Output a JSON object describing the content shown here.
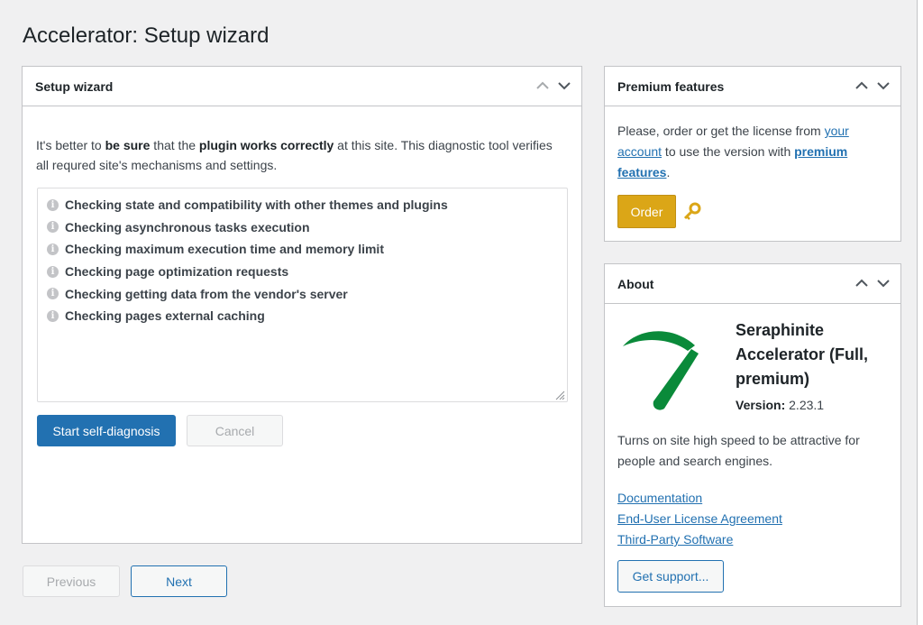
{
  "page": {
    "title": "Accelerator: Setup wizard"
  },
  "wizard": {
    "title": "Setup wizard",
    "intro": {
      "p1": "It's better to ",
      "b1": "be sure",
      "p2": " that the ",
      "b2": "plugin works correctly",
      "p3": " at this site. This diagnostic tool verifies all requred site's mechanisms and settings."
    },
    "checks": [
      "Checking state and compatibility with other themes and plugins",
      "Checking asynchronous tasks execution",
      "Checking maximum execution time and memory limit",
      "Checking page optimization requests",
      "Checking getting data from the vendor's server",
      "Checking pages external caching"
    ],
    "start_label": "Start self-diagnosis",
    "cancel_label": "Cancel"
  },
  "nav": {
    "previous_label": "Previous",
    "next_label": "Next"
  },
  "premium": {
    "title": "Premium features",
    "text1": "Please, order or get the license from ",
    "link1": "your account",
    "text2": " to use the version with ",
    "link2": "premium features",
    "text3": ".",
    "order_label": "Order"
  },
  "about": {
    "title": "About",
    "product_name": "Seraphinite Accelerator (Full, premium)",
    "version_label": "Version:",
    "version_value": " 2.23.1",
    "description": "Turns on site high speed to be attractive for people and search engines.",
    "links": [
      "Documentation",
      "End-User License Agreement",
      "Third-Party Software"
    ],
    "support_label": "Get support..."
  },
  "colors": {
    "primary": "#2271b1",
    "order": "#dba617",
    "logo_green": "#0a8a3a",
    "key": "#dba617"
  },
  "icons": [
    "chevron-up-icon",
    "chevron-down-icon",
    "info-icon",
    "key-icon",
    "resize-grip-icon",
    "logo-gauge-icon"
  ]
}
